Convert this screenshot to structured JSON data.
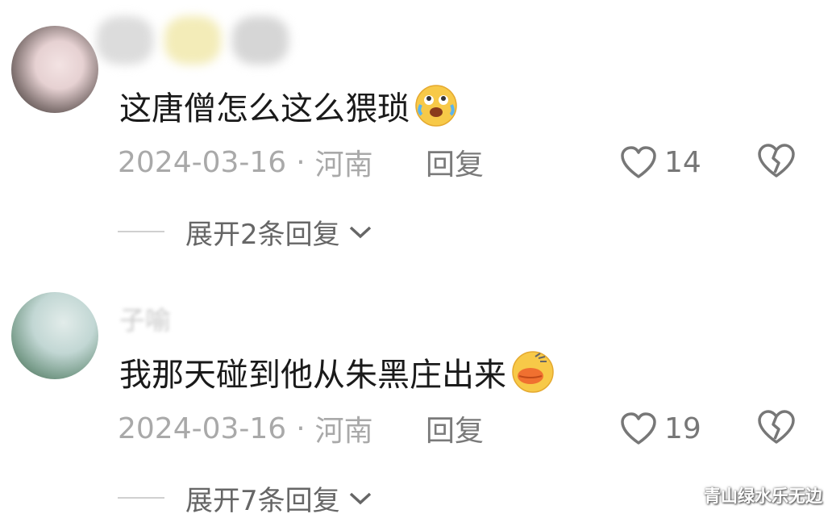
{
  "comments": [
    {
      "username": "",
      "text": "这唐僧怎么这么猥琐",
      "emoji": "crying-laughing-emoji",
      "date": "2024-03-16",
      "separator": "·",
      "location": "河南",
      "reply_label": "回复",
      "likes": "14",
      "expand_label": "展开2条回复"
    },
    {
      "username": "子喻",
      "text": "我那天碰到他从朱黑庄出来",
      "emoji": "kissing-duck-emoji",
      "date": "2024-03-16",
      "separator": "·",
      "location": "河南",
      "reply_label": "回复",
      "likes": "19",
      "expand_label": "展开7条回复"
    }
  ],
  "watermark": "青山绿水乐无边",
  "colors": {
    "text": "#1a1a1a",
    "meta": "#a9a9a9",
    "icon": "#777777"
  }
}
